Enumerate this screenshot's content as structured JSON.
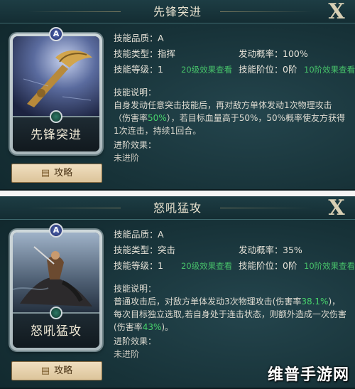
{
  "panels": [
    {
      "title": "先锋突进",
      "close_label": "X",
      "card": {
        "quality": "A",
        "name": "先锋突进"
      },
      "guide_label": "攻略",
      "stats": {
        "quality_label": "技能品质：",
        "quality_value": "A",
        "type_label": "技能类型：",
        "type_value": "指挥",
        "trigger_label": "发动概率：",
        "trigger_value": "100%",
        "level_label": "技能等级：",
        "level_value": "1",
        "level_link": "20级效果查看",
        "rank_label": "技能阶位：",
        "rank_value": "0阶",
        "rank_link": "10阶效果查看"
      },
      "desc_label": "技能说明：",
      "desc_line1": "自身发动任意突击技能后，再对敌方单体发动1次物理攻击",
      "desc_line2_a": "（伤害率",
      "desc_line2_hl": "50%",
      "desc_line2_b": "），若目标血量高于50%，50%概率使友方获得",
      "desc_line3": "1次连击，持续1回合。",
      "adv_label": "进阶效果：",
      "adv_value": "未进阶"
    },
    {
      "title": "怒吼猛攻",
      "close_label": "X",
      "card": {
        "quality": "A",
        "name": "怒吼猛攻"
      },
      "guide_label": "攻略",
      "stats": {
        "quality_label": "技能品质：",
        "quality_value": "A",
        "type_label": "技能类型：",
        "type_value": "突击",
        "trigger_label": "发动概率：",
        "trigger_value": "35%",
        "level_label": "技能等级：",
        "level_value": "1",
        "level_link": "20级效果查看",
        "rank_label": "技能阶位：",
        "rank_value": "0阶",
        "rank_link": "10阶效果查看"
      },
      "desc_label": "技能说明：",
      "desc_line1_a": "普通攻击后，对敌方单体发动3次物理攻击(伤害率",
      "desc_line1_hl": "38.1%",
      "desc_line1_b": ")，",
      "desc_line2": "每次目标独立选取,若自身处于连击状态，则额外造成一次伤害",
      "desc_line3_a": "(伤害率",
      "desc_line3_hl": "43%",
      "desc_line3_b": ")。",
      "adv_label": "进阶效果：",
      "adv_value": "未进阶"
    }
  ],
  "watermark": "维普手游网",
  "colors": {
    "highlight": "#47d36c",
    "panel_bg": "#173238",
    "title_text": "#e8e2cf"
  }
}
